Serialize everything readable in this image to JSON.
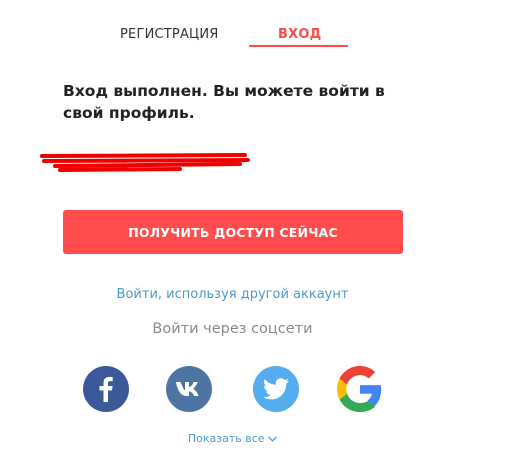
{
  "tabs": {
    "register_label": "РЕГИСТРАЦИЯ",
    "login_label": "ВХОД",
    "active_color": "#ff4a4a"
  },
  "message": "Вход выполнен. Вы можете войти в свой профиль.",
  "cta": {
    "label": "ПОЛУЧИТЬ ДОСТУП СЕЙЧАС",
    "color": "#ff4d4d"
  },
  "other_account_link": "Войти, используя другой аккаунт",
  "social": {
    "title": "Войти через соцсети",
    "providers": [
      "facebook-icon",
      "vk-icon",
      "twitter-icon",
      "google-icon"
    ]
  },
  "show_all": {
    "label": "Показать все",
    "icon": "chevron-down-icon"
  }
}
